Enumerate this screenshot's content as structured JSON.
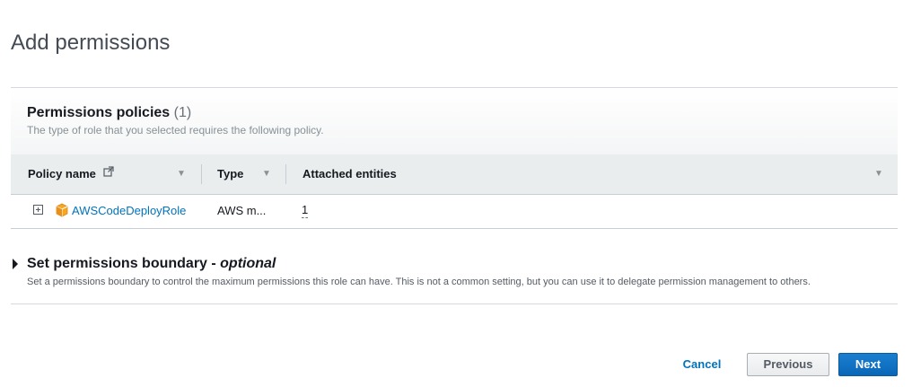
{
  "page": {
    "title": "Add permissions"
  },
  "policies_panel": {
    "title": "Permissions policies",
    "count": "(1)",
    "description": "The type of role that you selected requires the following policy.",
    "columns": [
      "Policy name",
      "Type",
      "Attached entities"
    ],
    "rows": [
      {
        "policy_name": "AWSCodeDeployRole",
        "type": "AWS m...",
        "attached_entities": "1"
      }
    ]
  },
  "boundary": {
    "title": "Set permissions boundary - ",
    "title_optional": "optional",
    "description": "Set a permissions boundary to control the maximum permissions this role can have. This is not a common setting, but you can use it to delegate permission management to others."
  },
  "footer": {
    "cancel_label": "Cancel",
    "previous_label": "Previous",
    "next_label": "Next"
  },
  "colors": {
    "link": "#0073bb",
    "primary_button": "#0a67b8",
    "table_header_bg": "#eaeded",
    "policy_icon": "#f5a623"
  },
  "icons": {
    "external_link": "external-link-icon",
    "expand": "plus-square-icon",
    "policy": "aws-managed-policy-cube-icon",
    "sort": "caret-down-icon",
    "boundary_toggle": "caret-right-icon"
  }
}
